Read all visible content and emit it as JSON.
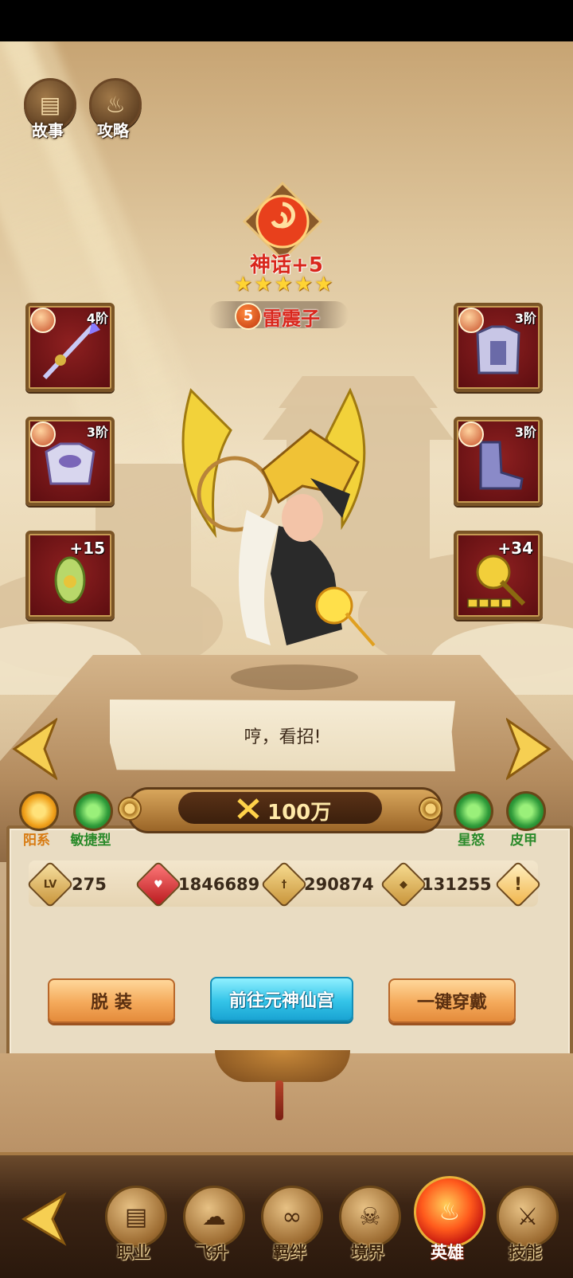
{
  "top_buttons": [
    {
      "label": "故事",
      "icon": "book-icon"
    },
    {
      "label": "攻略",
      "icon": "flame-icon"
    }
  ],
  "hero": {
    "rank": "神话+5",
    "stars": 5,
    "level_badge": "5",
    "name": "雷震子",
    "speech": "哼，看招!"
  },
  "equipment_left": [
    {
      "tier": "4阶",
      "icon": "spear-icon"
    },
    {
      "tier": "3阶",
      "icon": "armor-icon"
    },
    {
      "plus": "+15",
      "icon": "amulet-icon"
    }
  ],
  "equipment_right": [
    {
      "tier": "3阶",
      "icon": "robe-icon"
    },
    {
      "tier": "3阶",
      "icon": "boots-icon"
    },
    {
      "plus": "+34",
      "icon": "hammer-icon"
    }
  ],
  "power": {
    "value": "100万"
  },
  "attributes_left": [
    {
      "label": "阳系",
      "color": "#f2a21a"
    },
    {
      "label": "敏捷型",
      "color": "#2f9b3a"
    }
  ],
  "attributes_right": [
    {
      "label": "星怒",
      "color": "#2f9b3a"
    },
    {
      "label": "皮甲",
      "color": "#2f9b3a"
    }
  ],
  "stats": {
    "level_icon": "LV",
    "level": "275",
    "hp": "1846689",
    "attack": "290874",
    "defense": "131255",
    "info": "!"
  },
  "actions": {
    "unequip": "脱 装",
    "go_palace": "前往元神仙宫",
    "equip_all": "一键穿戴"
  },
  "nav": [
    {
      "label": "职业",
      "icon": "book-icon"
    },
    {
      "label": "飞升",
      "icon": "cloud-icon"
    },
    {
      "label": "羁绊",
      "icon": "knot-icon"
    },
    {
      "label": "境界",
      "icon": "skull-icon"
    },
    {
      "label": "英雄",
      "icon": "flame-icon",
      "active": true
    },
    {
      "label": "技能",
      "icon": "sword-icon"
    }
  ]
}
